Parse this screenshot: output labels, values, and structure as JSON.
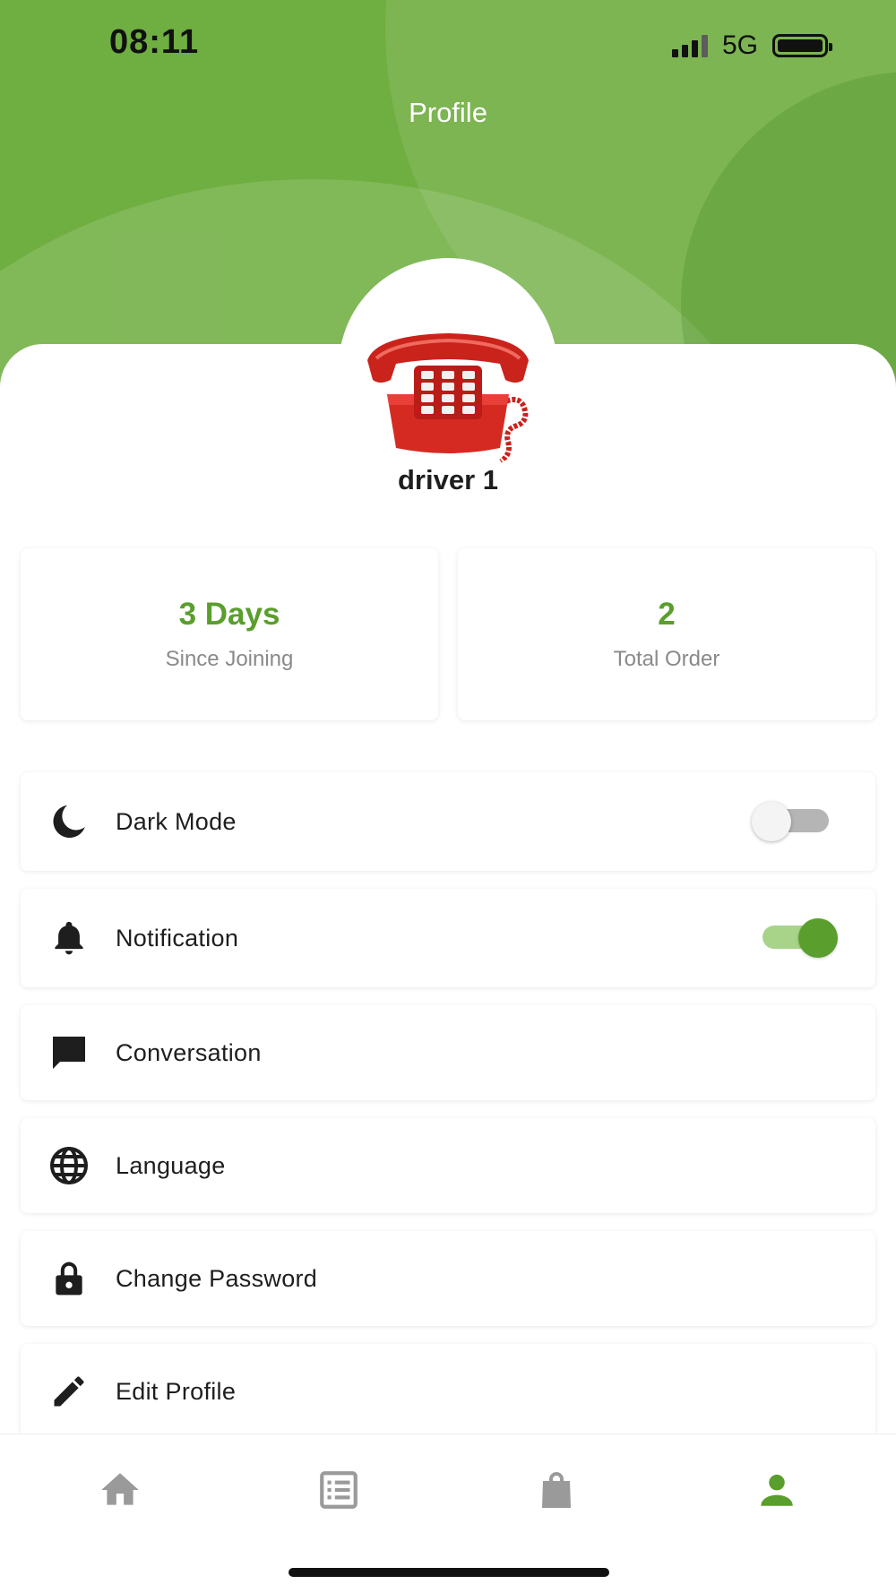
{
  "status_bar": {
    "time": "08:11",
    "network": "5G"
  },
  "header": {
    "title": "Profile"
  },
  "profile": {
    "name": "driver 1"
  },
  "stats": [
    {
      "value": "3 Days",
      "label": "Since Joining"
    },
    {
      "value": "2",
      "label": "Total Order"
    }
  ],
  "menu": [
    {
      "label": "Dark Mode",
      "icon": "moon-icon",
      "toggle": false
    },
    {
      "label": "Notification",
      "icon": "bell-icon",
      "toggle": true
    },
    {
      "label": "Conversation",
      "icon": "chat-icon"
    },
    {
      "label": "Language",
      "icon": "globe-icon"
    },
    {
      "label": "Change Password",
      "icon": "lock-icon"
    },
    {
      "label": "Edit Profile",
      "icon": "pencil-icon"
    }
  ],
  "bottom_nav": [
    {
      "icon": "home-icon",
      "active": false
    },
    {
      "icon": "orders-list-icon",
      "active": false
    },
    {
      "icon": "shopping-bag-icon",
      "active": false
    },
    {
      "icon": "person-icon",
      "active": true
    }
  ],
  "colors": {
    "primary": "#5a9e2d",
    "header": "#6fae40",
    "inactive_icon": "#9a9a9a"
  }
}
